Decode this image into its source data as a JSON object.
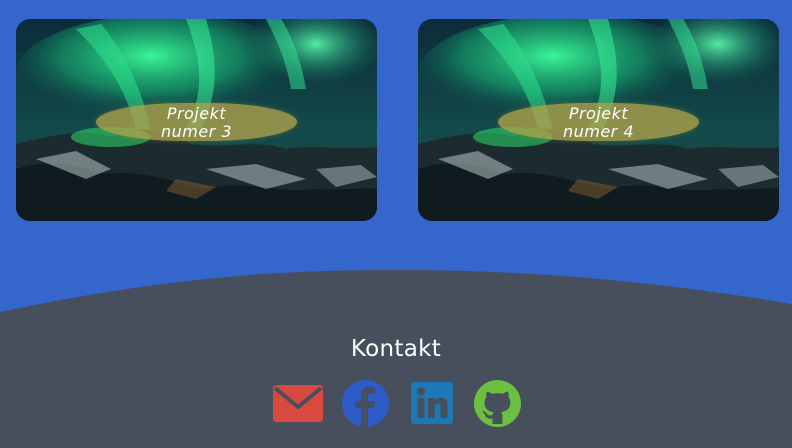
{
  "projects": [
    {
      "line1": "Projekt",
      "line2": "numer 3"
    },
    {
      "line1": "Projekt",
      "line2": "numer 4"
    }
  ],
  "footer": {
    "title": "Kontakt",
    "icons": [
      "email-icon",
      "facebook-icon",
      "linkedin-icon",
      "github-icon"
    ]
  },
  "colors": {
    "background": "#3566cc",
    "footer": "#474e5c",
    "email": "#d84a3f",
    "facebook": "#2f5bc8",
    "linkedin": "#1c78b6",
    "github": "#6cbf41",
    "caption_pill": "#b0a34a"
  }
}
